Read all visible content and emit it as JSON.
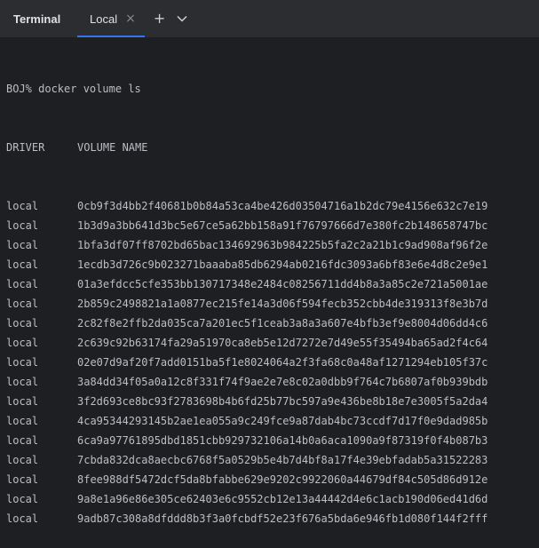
{
  "tabbar": {
    "title": "Terminal",
    "tab_label": "Local",
    "close_glyph": "×",
    "add_glyph": "+"
  },
  "terminal": {
    "prompt": "BOJ% docker volume ls",
    "headers": {
      "driver": "DRIVER",
      "volume": "VOLUME NAME"
    },
    "rows": [
      {
        "driver": "local",
        "name": "0cb9f3d4bb2f40681b0b84a53ca4be426d03504716a1b2dc79e4156e632c7e19"
      },
      {
        "driver": "local",
        "name": "1b3d9a3bb641d3bc5e67ce5a62bb158a91f76797666d7e380fc2b148658747bc"
      },
      {
        "driver": "local",
        "name": "1bfa3df07ff8702bd65bac134692963b984225b5fa2c2a21b1c9ad908af96f2e"
      },
      {
        "driver": "local",
        "name": "1ecdb3d726c9b023271baaaba85db6294ab0216fdc3093a6bf83e6e4d8c2e9e1"
      },
      {
        "driver": "local",
        "name": "01a3efdcc5cfe353bb130717348e2484c08256711dd4b8a3a85c2e721a5001ae"
      },
      {
        "driver": "local",
        "name": "2b859c2498821a1a0877ec215fe14a3d06f594fecb352cbb4de319313f8e3b7d"
      },
      {
        "driver": "local",
        "name": "2c82f8e2ffb2da035ca7a201ec5f1ceab3a8a3a607e4bfb3ef9e8004d06dd4c6"
      },
      {
        "driver": "local",
        "name": "2c639c92b63174fa29a51970ca8eb5e12d7272e7d49e55f35494ba65ad2f4c64"
      },
      {
        "driver": "local",
        "name": "02e07d9af20f7add0151ba5f1e8024064a2f3fa68c0a48af1271294eb105f37c"
      },
      {
        "driver": "local",
        "name": "3a84dd34f05a0a12c8f331f74f9ae2e7e8c02a0dbb9f764c7b6807af0b939bdb"
      },
      {
        "driver": "local",
        "name": "3f2d693ce8bc93f2783698b4b6fd25b77bc597a9e436be8b18e7e3005f5a2da4"
      },
      {
        "driver": "local",
        "name": "4ca95344293145b2ae1ea055a9c249fce9a87dab4bc73ccdf7d17f0e9dad985b"
      },
      {
        "driver": "local",
        "name": "6ca9a97761895dbd1851cbb929732106a14b0a6aca1090a9f87319f0f4b087b3"
      },
      {
        "driver": "local",
        "name": "7cbda832dca8aecbc6768f5a0529b5e4b7d4bf8a17f4e39ebfadab5a31522283"
      },
      {
        "driver": "local",
        "name": "8fee988df5472dcf5da8bfabbe629e9202c9922060a44679df84c505d86d912e"
      },
      {
        "driver": "local",
        "name": "9a8e1a96e86e305ce62403e6c9552cb12e13a44442d4e6c1acb190d06ed41d6d"
      },
      {
        "driver": "local",
        "name": "9adb87c308a8dfddd8b3f3a0fcbdf52e23f676a5bda6e946fb1d080f144f2fff"
      }
    ]
  }
}
